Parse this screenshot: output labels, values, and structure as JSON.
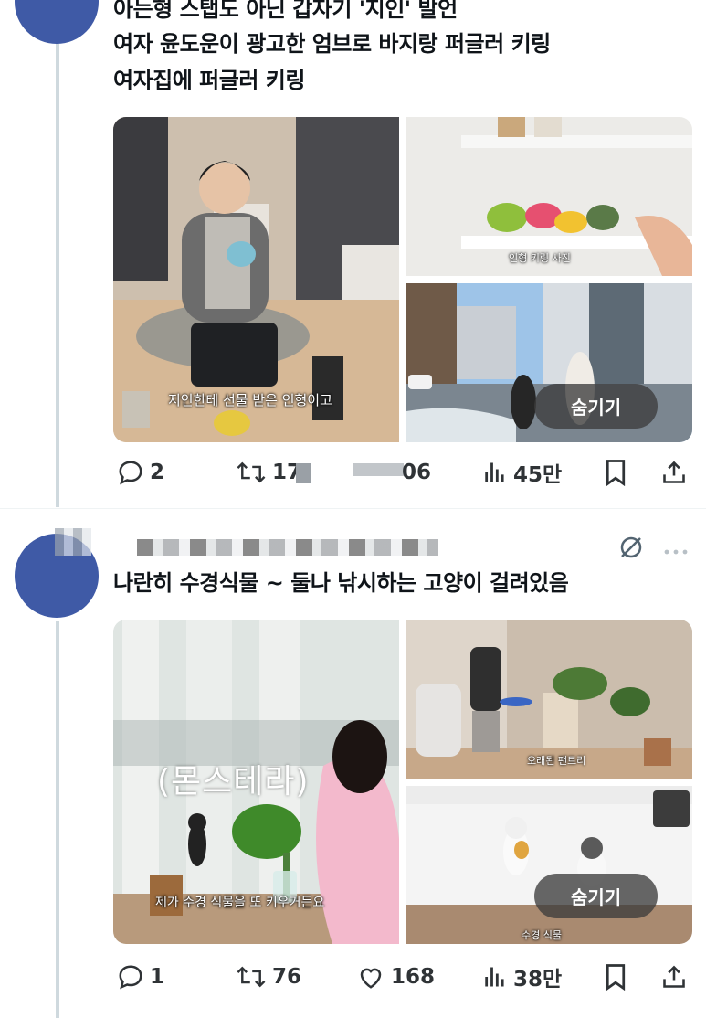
{
  "tweet1": {
    "lines": [
      "아는형 스탭도 아닌 갑자기 '지인' 발언",
      "여자 윤도운이 광고한 엄브로 바지랑 퍼글러 키링",
      "여자집에 퍼글러 키링"
    ],
    "media": {
      "caption_main": "지인한테 선물 받은 인형이고",
      "caption_shelf": "인형 키링 사진",
      "hide_label": "숨기기"
    },
    "actions": {
      "replies": "2",
      "retweets": "17",
      "likes": "06",
      "views": "45만"
    }
  },
  "tweet2": {
    "text": "나란히 수경식물 ~ 둘나 낚시하는 고양이 걸려있음",
    "media": {
      "overlay_text": "(몬스테라)",
      "caption_left": "제가 수경 식물을 또 키우거든요",
      "caption_room": "오래된 팬트리",
      "caption_cats": "수경 식물",
      "hide_label": "숨기기"
    },
    "actions": {
      "replies": "1",
      "retweets": "76",
      "likes": "168",
      "views": "38만"
    }
  },
  "colors": {
    "avatar": "#3f5aa6",
    "thread_line": "#cfd9de",
    "icon": "#536471"
  },
  "icons": [
    "reply-icon",
    "retweet-icon",
    "like-icon",
    "views-icon",
    "bookmark-icon",
    "share-icon",
    "grok-icon",
    "more-icon"
  ]
}
